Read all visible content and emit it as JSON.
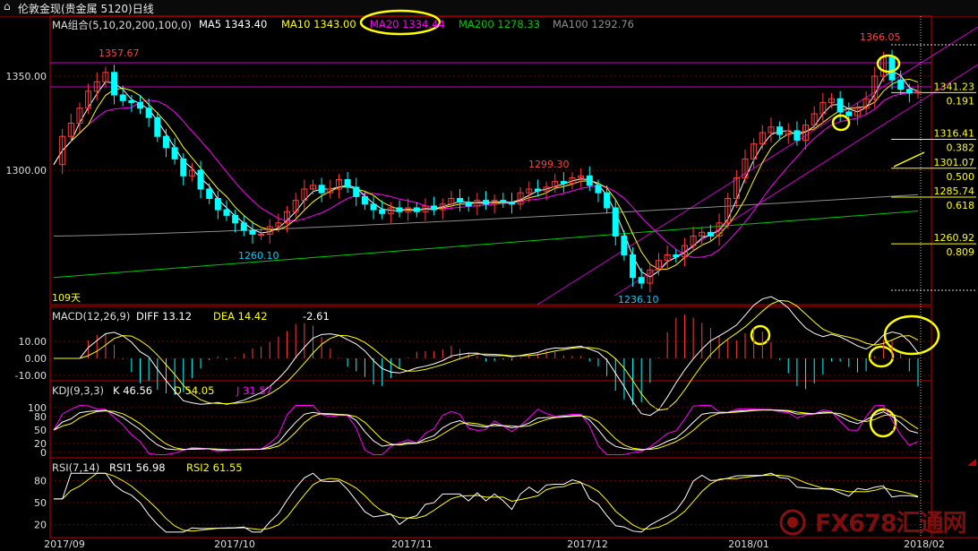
{
  "title": "伦敦金现(贵金属 5120)日线",
  "main": {
    "indicator": "MA组合(5,10,20,200,100,0)",
    "ma": [
      {
        "label": "MA5 1343.40",
        "color": "#ffffff"
      },
      {
        "label": "MA10 1343.00",
        "color": "#ffff00"
      },
      {
        "label": "MA20 1334.44",
        "color": "#ff00ff"
      },
      {
        "label": "MA200 1278.33",
        "color": "#00cc00"
      },
      {
        "label": "MA100 1292.76",
        "color": "#8c8c8c"
      }
    ],
    "y_ticks": [
      {
        "v": 1350,
        "t": "1350.00"
      },
      {
        "v": 1300,
        "t": "1300.00"
      }
    ],
    "annotations": {
      "high1": "1357.67",
      "low1": "1260.10",
      "mid": "1299.30",
      "low2": "1236.10",
      "high2": "1366.05",
      "days": "109天"
    },
    "fib": [
      {
        "price": "1341.23",
        "ratio": "0.191"
      },
      {
        "price": "1316.41",
        "ratio": "0.382"
      },
      {
        "price": "1301.07",
        "ratio": "0.500"
      },
      {
        "price": "1285.74",
        "ratio": "0.618"
      },
      {
        "price": "1260.92",
        "ratio": "0.809"
      }
    ]
  },
  "macd": {
    "indicator": "MACD(12,26,9)",
    "diff": "DIFF  13.12",
    "dea": "DEA  14.42",
    "macd": "-2.61",
    "y_ticks": [
      "10.00",
      "0.00",
      "-10.00"
    ]
  },
  "kdj": {
    "indicator": "KDJ(9,3,3)",
    "k": "K  46.56",
    "d": "D  54.05",
    "j": "J  31.57",
    "y_ticks": [
      "100",
      "80",
      "50",
      "20",
      "0"
    ]
  },
  "rsi": {
    "indicator": "RSI(7,14)",
    "rsi1": "RSI1  56.98",
    "rsi2": "RSI2  61.55",
    "y_ticks": [
      "80",
      "50",
      "20"
    ]
  },
  "x_labels": [
    "2017/09",
    "2017/10",
    "2017/11",
    "2017/12",
    "2018/01",
    "2018/02"
  ],
  "watermark": "FX678汇通网",
  "colors": {
    "up": "#ff3b3b",
    "down": "#00ffff",
    "grid": "#7a0000",
    "axis": "#c00000"
  },
  "chart_data": {
    "type": "candlestick",
    "title": "伦敦金现(贵金属 5120)日线",
    "xlabel": "",
    "ylabel": "",
    "ylim": [
      1228,
      1370
    ],
    "dates": [
      "2017/09",
      "2017/10",
      "2017/11",
      "2017/12",
      "2018/01",
      "2018/02"
    ],
    "key_levels": {
      "high_2017_09": 1357.67,
      "low_2017_10": 1260.1,
      "mid_2017_11": 1299.3,
      "low_2017_12": 1236.1,
      "high_2018_01": 1366.05
    },
    "fibonacci": [
      {
        "ratio": 0.191,
        "price": 1341.23
      },
      {
        "ratio": 0.382,
        "price": 1316.41
      },
      {
        "ratio": 0.5,
        "price": 1301.07
      },
      {
        "ratio": 0.618,
        "price": 1285.74
      },
      {
        "ratio": 0.809,
        "price": 1260.92
      }
    ],
    "close_path": [
      1303,
      1318,
      1325,
      1333,
      1342,
      1347,
      1352,
      1340,
      1337,
      1336,
      1333,
      1328,
      1318,
      1312,
      1306,
      1297,
      1300,
      1290,
      1285,
      1279,
      1276,
      1272,
      1268,
      1266,
      1266,
      1270,
      1272,
      1278,
      1284,
      1290,
      1292,
      1288,
      1290,
      1295,
      1291,
      1286,
      1282,
      1279,
      1277,
      1280,
      1278,
      1280,
      1278,
      1281,
      1279,
      1282,
      1285,
      1283,
      1281,
      1284,
      1282,
      1284,
      1283,
      1282,
      1288,
      1290,
      1289,
      1291,
      1294,
      1293,
      1296,
      1297,
      1292,
      1288,
      1280,
      1265,
      1255,
      1243,
      1240,
      1247,
      1252,
      1255,
      1254,
      1260,
      1265,
      1267,
      1265,
      1272,
      1285,
      1296,
      1306,
      1314,
      1320,
      1323,
      1319,
      1321,
      1316,
      1324,
      1330,
      1336,
      1338,
      1331,
      1329,
      1333,
      1338,
      1350,
      1360,
      1348,
      1343,
      1341,
      1342
    ],
    "ma_latest": {
      "MA5": 1343.4,
      "MA10": 1343.0,
      "MA20": 1334.44,
      "MA200": 1278.33,
      "MA100": 1292.76
    },
    "macd_latest": {
      "DIFF": 13.12,
      "DEA": 14.42,
      "MACD": -2.61
    },
    "kdj_latest": {
      "K": 46.56,
      "D": 54.05,
      "J": 31.57
    },
    "rsi_latest": {
      "RSI1": 56.98,
      "RSI2": 61.55
    }
  }
}
